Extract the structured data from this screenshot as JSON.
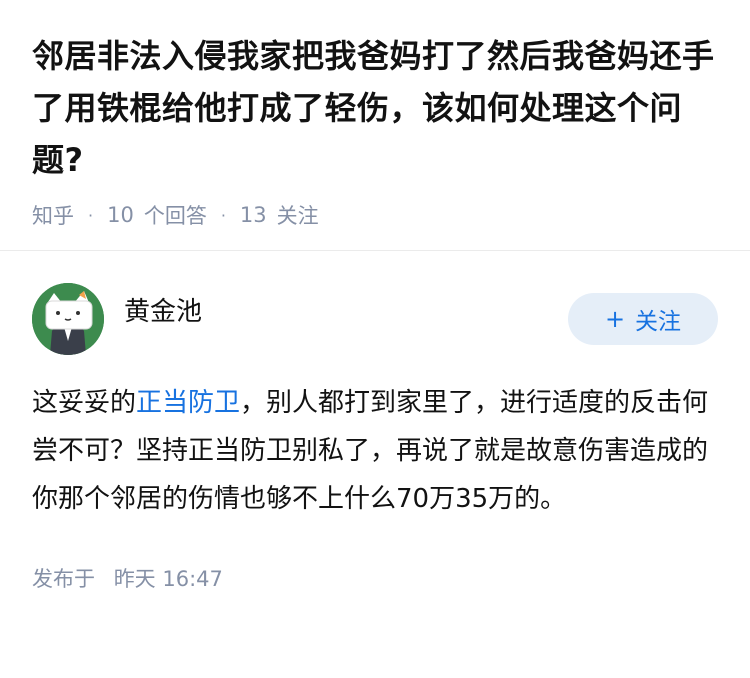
{
  "question": {
    "title": "邻居非法入侵我家把我爸妈打了然后我爸妈还手了用铁棍给他打成了轻伤，该如何处理这个问题?",
    "source": "知乎",
    "answer_count": "10",
    "answer_label": "个回答",
    "follow_count": "13",
    "follow_label": "关注"
  },
  "answer": {
    "author_name": "黄金池",
    "follow_button_label": "关注",
    "follow_button_icon": "plus-icon",
    "content_before_link": "这妥妥的",
    "content_link": "正当防卫",
    "content_after_link": "，别人都打到家里了，进行适度的反击何尝不可？坚持正当防卫别私了，再说了就是故意伤害造成的你那个邻居的伤情也够不上什么70万35万的。",
    "published_label": "发布于",
    "published_time": "昨天 16:47"
  },
  "colors": {
    "link": "#1772e0",
    "meta": "#8590a6",
    "follow_bg": "#e5eef8",
    "avatar_bg": "#3d8b4e"
  }
}
